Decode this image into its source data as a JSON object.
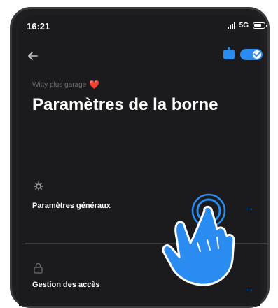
{
  "status": {
    "time": "16:21",
    "network": "5G"
  },
  "header": {
    "back_icon": "arrow-left-icon",
    "toggle_on": true
  },
  "subtitle": {
    "text": "Witty plus garage",
    "heart": "❤️"
  },
  "title": "Paramètres de la borne",
  "rows": [
    {
      "icon": "gear-icon",
      "label": "Paramètres généraux"
    },
    {
      "icon": "lock-icon",
      "label": "Gestion des accès"
    }
  ],
  "colors": {
    "accent": "#2a8cf0",
    "background": "#1b1b1d",
    "heart": "#e0302c"
  }
}
